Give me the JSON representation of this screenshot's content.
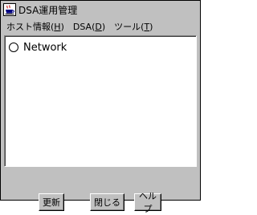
{
  "window": {
    "title": "DSA運用管理",
    "app_icon": "java-coffee-cup-icon"
  },
  "menubar": {
    "items": [
      {
        "label": "ホスト情報",
        "mnemonic": "H"
      },
      {
        "label": "DSA",
        "mnemonic": "D"
      },
      {
        "label": "ツール",
        "mnemonic": "T"
      }
    ]
  },
  "tree": {
    "nodes": [
      {
        "label": "Network",
        "icon": "radio-circle-icon"
      }
    ]
  },
  "buttons": {
    "refresh_label": "更新",
    "close_label": "閉じる",
    "help_label": "ヘルプ"
  }
}
